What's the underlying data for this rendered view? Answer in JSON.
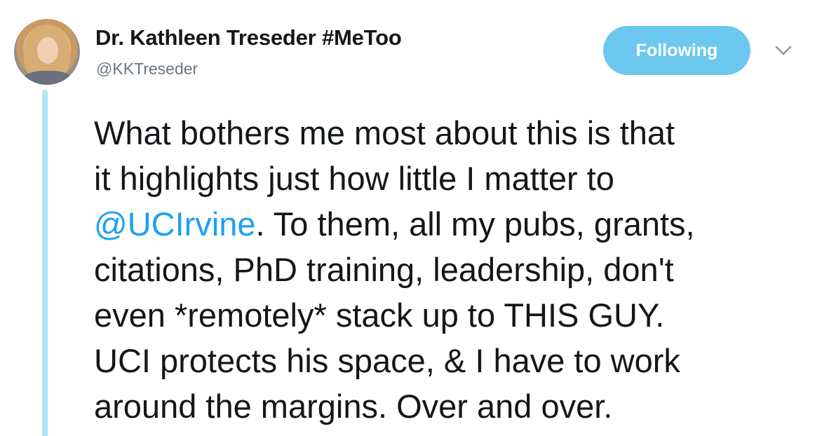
{
  "tweet": {
    "author": {
      "display_name": "Dr. Kathleen Treseder #MeToo",
      "handle": "@KKTreseder",
      "avatar_icon": "profile-photo"
    },
    "follow_button_label": "Following",
    "menu_icon": "chevron-down-icon",
    "accent_color": "#1da1f2",
    "button_color": "#6cc8ef",
    "thread_line_color": "#b2e2f8",
    "text_lines": [
      {
        "text": "What bothers me most about this is that"
      },
      {
        "text": "it highlights just how little I matter to"
      },
      {
        "mention": "@UCIrvine",
        "text": ". To them, all my pubs, grants,"
      },
      {
        "text": "citations, PhD training, leadership, don't"
      },
      {
        "text": "even *remotely* stack up to THIS GUY."
      },
      {
        "text": "UCI protects his space, & I have to work"
      },
      {
        "text": "around the margins. Over and over."
      }
    ]
  }
}
